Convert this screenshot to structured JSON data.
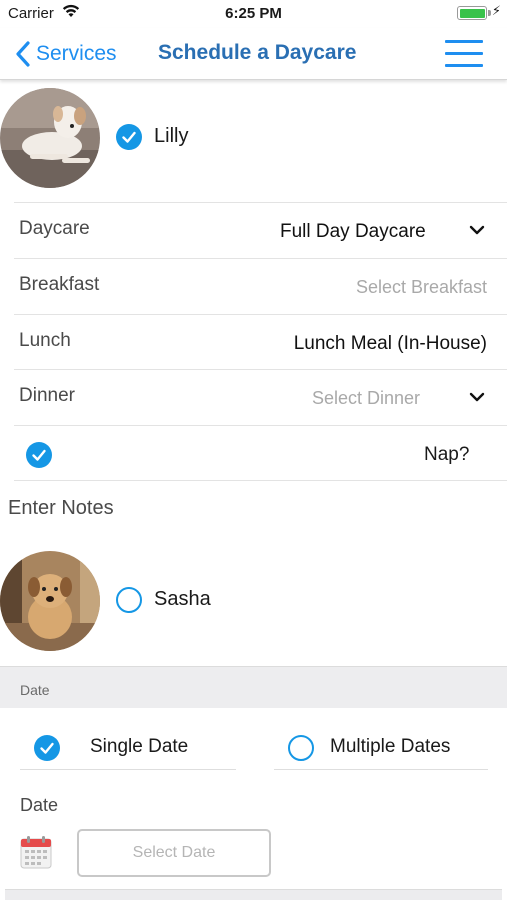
{
  "status_bar": {
    "carrier": "Carrier",
    "time": "6:25 PM",
    "battery_level": 1.0
  },
  "nav": {
    "back_label": "Services",
    "title": "Schedule a Daycare",
    "menu_icon": "hamburger-menu-icon"
  },
  "pets": [
    {
      "name": "Lilly",
      "selected": true
    },
    {
      "name": "Sasha",
      "selected": false
    }
  ],
  "form": {
    "daycare": {
      "label": "Daycare",
      "value": "Full Day Daycare"
    },
    "breakfast": {
      "label": "Breakfast",
      "placeholder": "Select Breakfast"
    },
    "lunch": {
      "label": "Lunch",
      "value": "Lunch Meal (In-House)"
    },
    "dinner": {
      "label": "Dinner",
      "placeholder": "Select Dinner"
    },
    "nap": {
      "label": "Nap?",
      "checked": true
    },
    "notes_label": "Enter Notes"
  },
  "date_section": {
    "header": "Date",
    "options": [
      {
        "label": "Single Date",
        "selected": true
      },
      {
        "label": "Multiple Dates",
        "selected": false
      }
    ],
    "date_label": "Date",
    "date_placeholder": "Select Date"
  },
  "colors": {
    "accent": "#1597e5",
    "nav_title": "#2a6fb3",
    "back": "#1e8ef0"
  }
}
